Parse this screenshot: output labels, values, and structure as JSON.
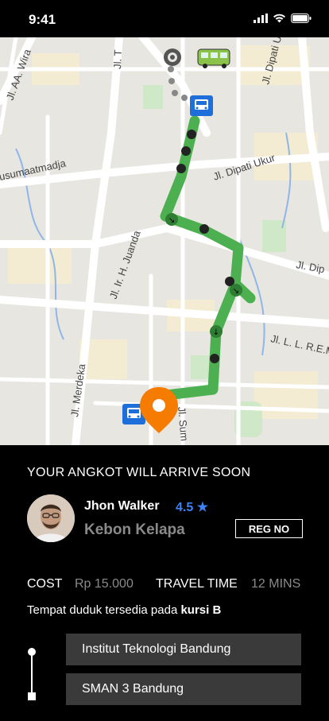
{
  "status_bar": {
    "time": "9:41"
  },
  "map": {
    "street_labels": [
      "Jl. T",
      "Jl. AA. Wira",
      "Jl. Dipati Ukur",
      "Jl. Dipati Ukur",
      "usumaatmadja",
      "Jl. Ir. H. Juanda",
      "Jl. Dip",
      "Jl. L. L. R.E.M",
      "Jl. Merdeka",
      "Jl. Sum"
    ],
    "route_color": "#4caf50",
    "destination_pin_color": "#f57c00",
    "bus_stop_color": "#1e6fd9"
  },
  "arrival": {
    "headline": "YOUR ANGKOT WILL ARRIVE SOON",
    "driver_name": "Jhon Walker",
    "rating": "4.5 ★",
    "route_name": "Kebon Kelapa",
    "reg_button": "REG NO"
  },
  "trip": {
    "cost_label": "COST",
    "cost_value": "Rp 15.000",
    "travel_time_label": "TRAVEL TIME",
    "travel_time_value": "12 MINS",
    "seat_text": "Tempat duduk tersedia pada ",
    "seat_highlight": "kursi B"
  },
  "stops": [
    {
      "name": "Institut Teknologi Bandung"
    },
    {
      "name": "SMAN 3 Bandung"
    }
  ]
}
